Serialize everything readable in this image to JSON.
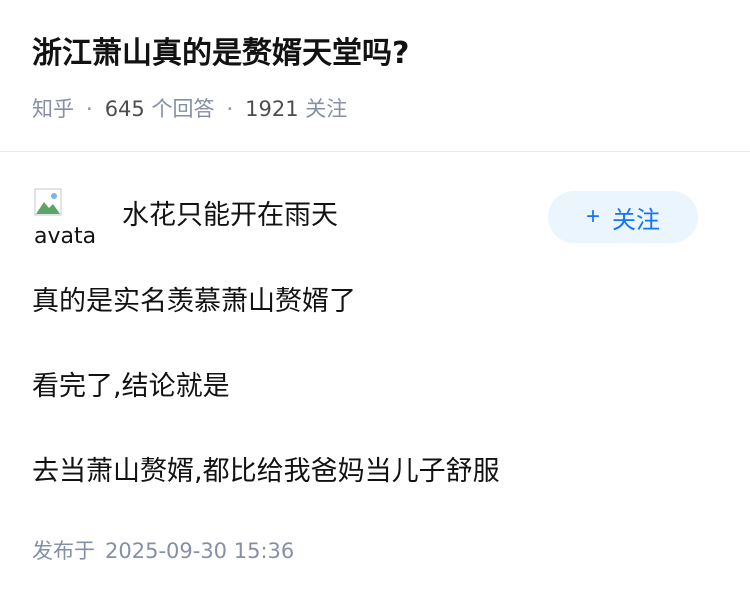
{
  "question": {
    "title": "浙江萧山真的是赘婿天堂吗?",
    "source": "知乎",
    "answer_count": "645",
    "answer_label": "个回答",
    "follower_count": "1921",
    "follower_label": "关注"
  },
  "author": {
    "avatar_alt": "avatar",
    "name": "水花只能开在雨天",
    "follow_label": "关注"
  },
  "answer": {
    "paragraphs": [
      "真的是实名羡慕萧山赘婿了",
      "看完了,结论就是",
      "去当萧山赘婿,都比给我爸妈当儿子舒服"
    ]
  },
  "footer": {
    "published_label": "发布于",
    "published_at": "2025-09-30 15:36"
  },
  "colors": {
    "accent": "#1772f6",
    "follow_bg": "#ebf5fd",
    "meta_text": "#8590a6"
  }
}
